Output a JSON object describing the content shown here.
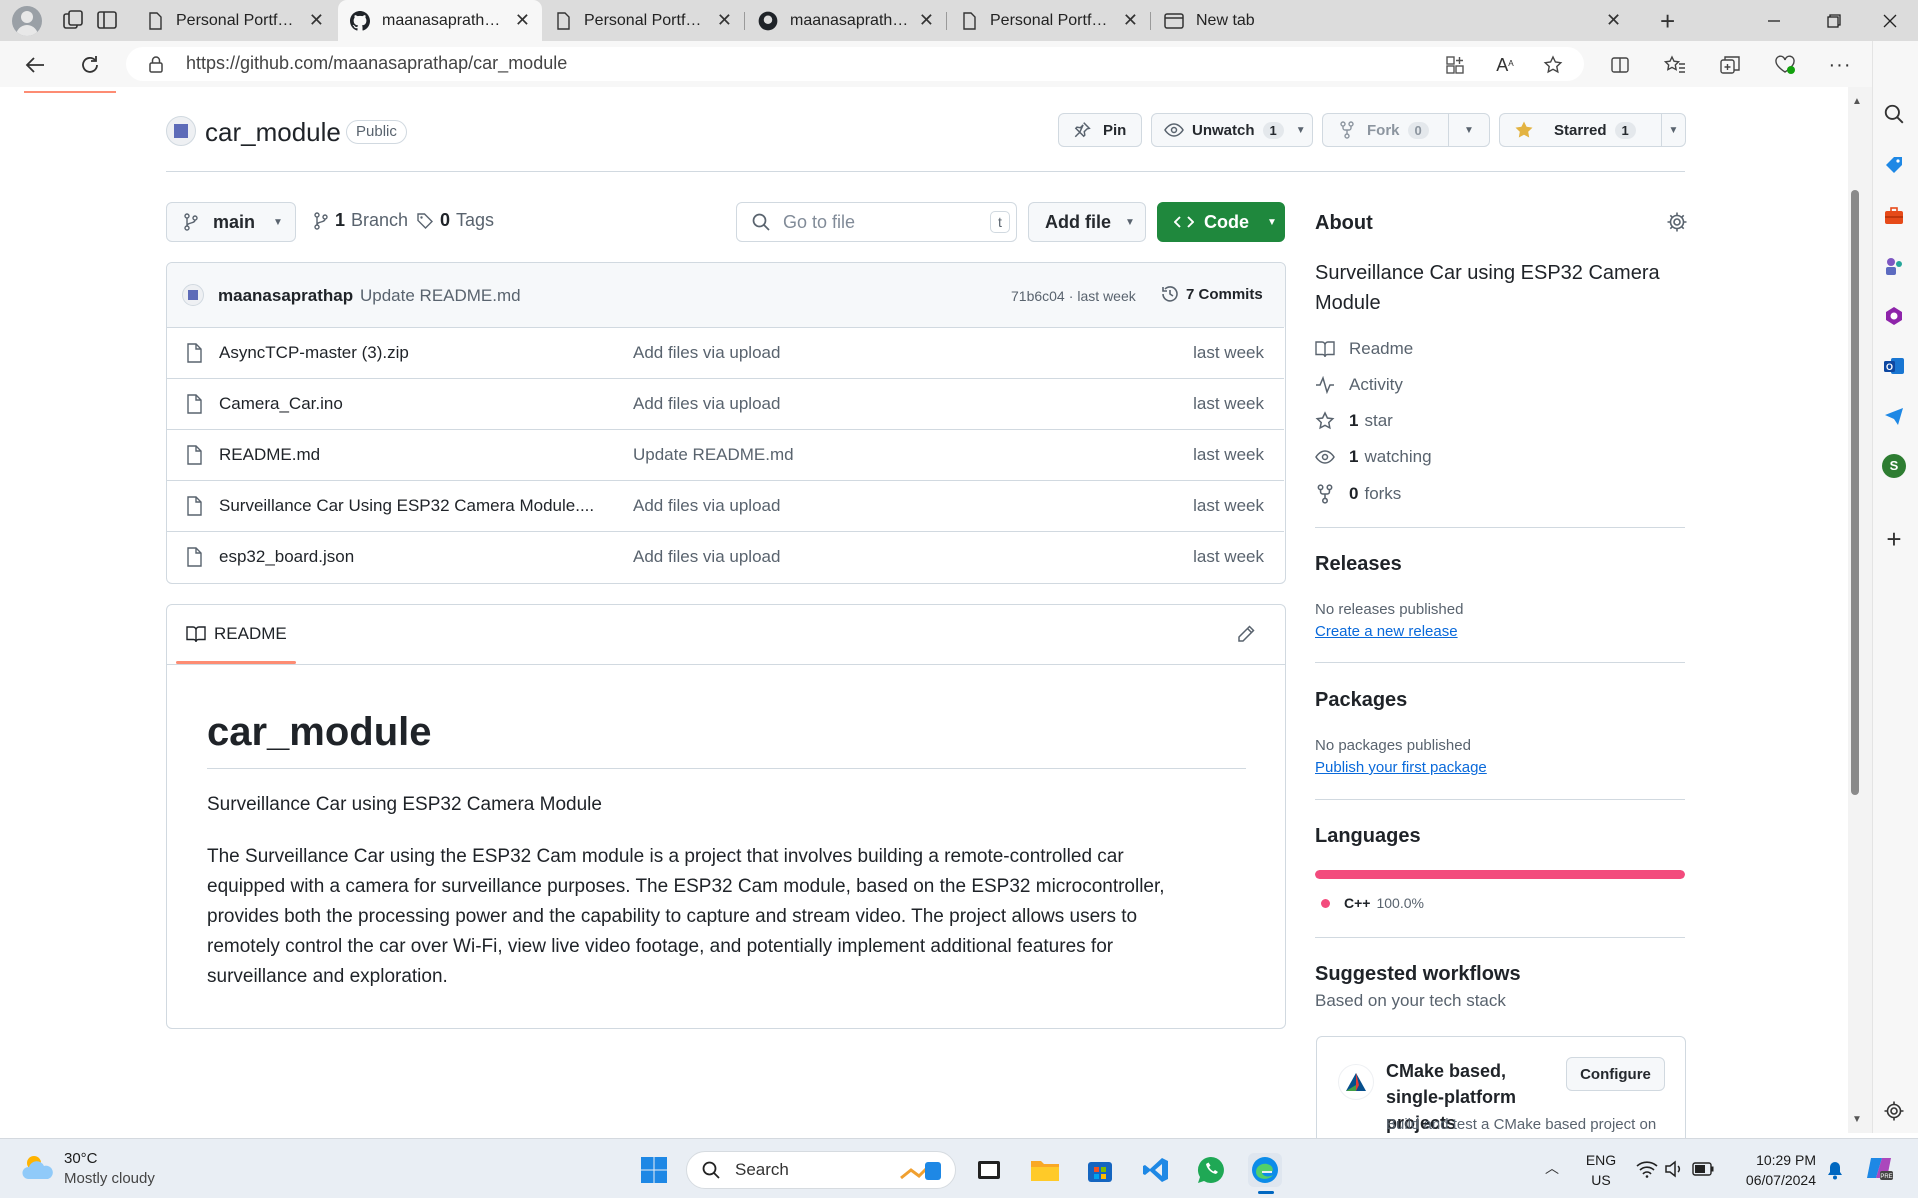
{
  "browser": {
    "tabs": [
      {
        "label": "Personal Portfolio Websit",
        "icon": "doc-icon"
      },
      {
        "label": "maanasaprathap/car_mo",
        "icon": "github-icon",
        "active": true
      },
      {
        "label": "Personal Portfolio Websit",
        "icon": "doc-icon"
      },
      {
        "label": "maanasaprathap/car_mo",
        "icon": "github-icon"
      },
      {
        "label": "Personal Portfolio Websit",
        "icon": "doc-icon"
      },
      {
        "label": "New tab",
        "icon": "newtab-icon"
      }
    ],
    "url": "https://github.com/maanasaprathap/car_module"
  },
  "repo": {
    "name": "car_module",
    "visibility": "Public",
    "pin_label": "Pin",
    "unwatch_label": "Unwatch",
    "watch_count": "1",
    "fork_label": "Fork",
    "fork_count": "0",
    "star_label": "Starred",
    "star_count": "1"
  },
  "toolbar": {
    "branch": "main",
    "branch_count": "1",
    "branch_label": "Branch",
    "tag_count": "0",
    "tag_label": "Tags",
    "search_placeholder": "Go to file",
    "search_key": "t",
    "add_file": "Add file",
    "code": "Code"
  },
  "commit": {
    "author": "maanasaprathap",
    "message": "Update README.md",
    "hash": "71b6c04",
    "separator": "·",
    "time": "last week",
    "count": "7 Commits"
  },
  "files": [
    {
      "name": "AsyncTCP-master (3).zip",
      "message": "Add files via upload",
      "time": "last week"
    },
    {
      "name": "Camera_Car.ino",
      "message": "Add files via upload",
      "time": "last week"
    },
    {
      "name": "README.md",
      "message": "Update README.md",
      "time": "last week"
    },
    {
      "name": "Surveillance Car Using ESP32 Camera Module....",
      "message": "Add files via upload",
      "time": "last week"
    },
    {
      "name": "esp32_board.json",
      "message": "Add files via upload",
      "time": "last week"
    }
  ],
  "readme": {
    "tab": "README",
    "title": "car_module",
    "subtitle": "Surveillance Car using ESP32 Camera Module",
    "body": "The Surveillance Car using the ESP32 Cam module is a project that involves building a remote-controlled car equipped with a camera for surveillance purposes. The ESP32 Cam module, based on the ESP32 microcontroller, provides both the processing power and the capability to capture and stream video. The project allows users to remotely control the car over Wi-Fi, view live video footage, and potentially implement additional features for surveillance and exploration."
  },
  "about": {
    "title": "About",
    "description": "Surveillance Car using ESP32 Camera Module",
    "readme": "Readme",
    "activity": "Activity",
    "stars_count": "1",
    "stars_label": "star",
    "watching_count": "1",
    "watching_label": "watching",
    "forks_count": "0",
    "forks_label": "forks"
  },
  "releases": {
    "title": "Releases",
    "none": "No releases published",
    "link": "Create a new release"
  },
  "packages": {
    "title": "Packages",
    "none": "No packages published",
    "link": "Publish your first package"
  },
  "languages": {
    "title": "Languages",
    "name": "C++",
    "percent": "100.0%",
    "share": 1.0,
    "color": "#f34b7d"
  },
  "workflows": {
    "title": "Suggested workflows",
    "subtitle": "Based on your tech stack",
    "item_title": "CMake based, single-platform projects",
    "item_desc": "Build and test a CMake based project on",
    "configure": "Configure"
  },
  "taskbar": {
    "temp": "30°C",
    "weather": "Mostly cloudy",
    "search": "Search",
    "lang1": "ENG",
    "lang2": "US",
    "time": "10:29 PM",
    "date": "06/07/2024"
  },
  "colors": {
    "accent_green": "#1f883d",
    "link": "#0969da",
    "readme_tab_underline": "#fd8c73"
  }
}
